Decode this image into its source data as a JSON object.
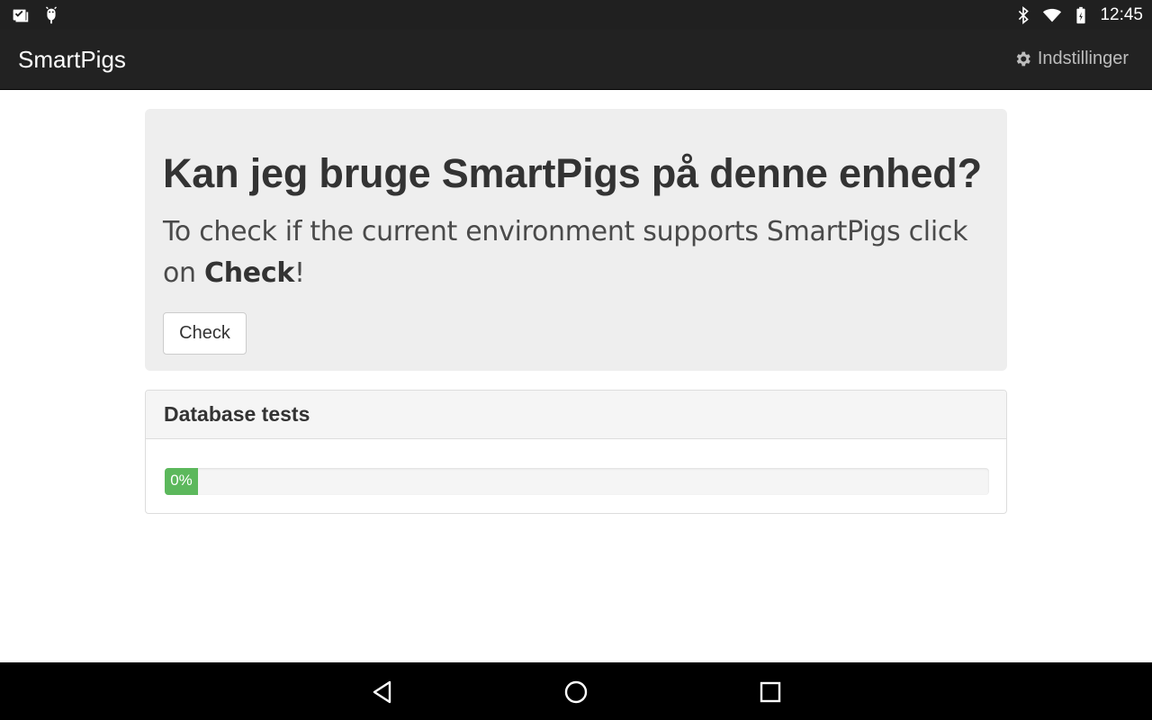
{
  "status_bar": {
    "time": "12:45",
    "left_icons": [
      "notification-inbox-icon",
      "android-debug-icon"
    ],
    "right_icons": [
      "bluetooth-icon",
      "wifi-icon",
      "battery-charging-icon"
    ]
  },
  "app_bar": {
    "title": "SmartPigs",
    "settings_label": "Indstillinger",
    "settings_icon": "gear-icon"
  },
  "jumbotron": {
    "title": "Kan jeg bruge SmartPigs på denne enhed?",
    "lead_text": "To check if the current environment supports SmartPigs click on ",
    "lead_bold": "Check",
    "lead_end": "!",
    "button_label": "Check"
  },
  "panel": {
    "heading": "Database tests",
    "progress_value": 0,
    "progress_label": "0%",
    "progress_color": "#5cb85c"
  },
  "nav_bar": {
    "buttons": [
      "back-icon",
      "home-icon",
      "recents-icon"
    ]
  },
  "colors": {
    "app_bar_bg": "#222222",
    "status_bar_bg": "#202020",
    "jumbotron_bg": "#eeeeee",
    "success": "#5cb85c"
  }
}
